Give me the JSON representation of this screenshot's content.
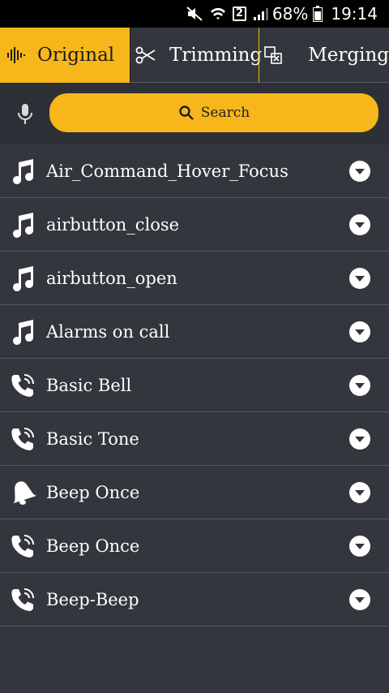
{
  "status_bar": {
    "sim": "2",
    "battery_percent": "68%",
    "time": "19:14"
  },
  "tabs": [
    {
      "label": "Original",
      "icon": "waveform-icon",
      "active": true
    },
    {
      "label": "Trimming",
      "icon": "scissors-icon",
      "active": false
    },
    {
      "label": "Merging",
      "icon": "merge-icon",
      "active": false
    }
  ],
  "search": {
    "label": "Search"
  },
  "items": [
    {
      "label": "Air_Command_Hover_Focus",
      "icon": "music-note-icon"
    },
    {
      "label": "airbutton_close",
      "icon": "music-note-icon"
    },
    {
      "label": "airbutton_open",
      "icon": "music-note-icon"
    },
    {
      "label": "Alarms on call",
      "icon": "music-note-icon"
    },
    {
      "label": "Basic Bell",
      "icon": "phone-ring-icon"
    },
    {
      "label": "Basic Tone",
      "icon": "phone-ring-icon"
    },
    {
      "label": "Beep Once",
      "icon": "bell-icon"
    },
    {
      "label": "Beep Once",
      "icon": "phone-ring-icon"
    },
    {
      "label": "Beep-Beep",
      "icon": "phone-ring-icon"
    }
  ],
  "colors": {
    "accent": "#f7b71a",
    "background": "#33363d",
    "search_row": "#2d3036",
    "divider": "#55585e"
  }
}
